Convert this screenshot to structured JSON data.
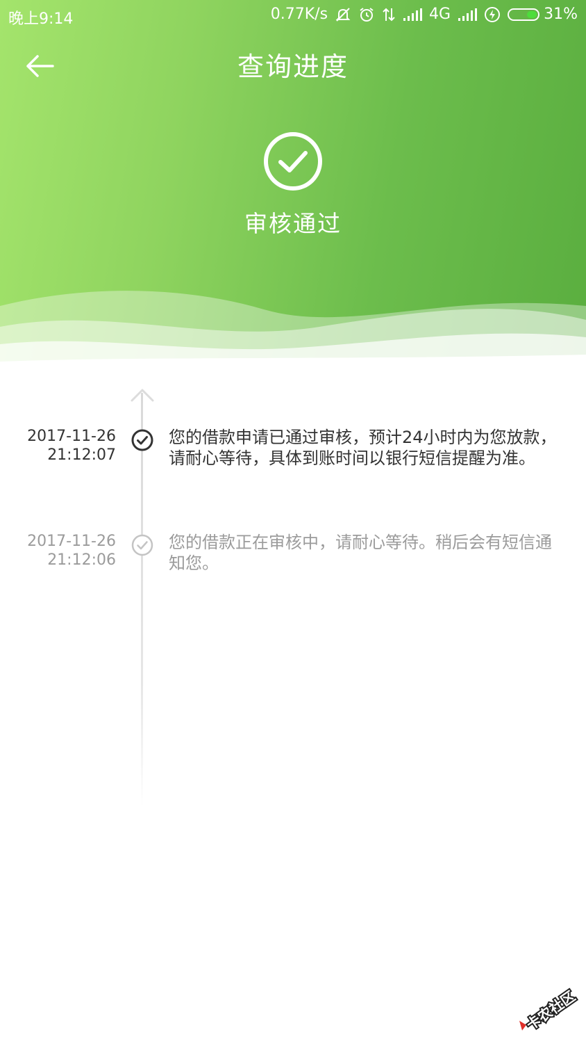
{
  "status_bar": {
    "time": "晚上9:14",
    "net_speed": "0.77K/s",
    "network_type": "4G",
    "battery_percent": "31%",
    "icons": [
      "mute-icon",
      "alarm-icon",
      "data-arrows-icon",
      "signal-icon",
      "signal-icon",
      "charging-icon",
      "battery-icon"
    ]
  },
  "header": {
    "title": "查询进度",
    "back_icon": "back-arrow-icon",
    "status_icon": "check-circle-icon",
    "status_text": "审核通过"
  },
  "timeline": {
    "entries": [
      {
        "date": "2017-11-26",
        "time": "21:12:07",
        "message": "您的借款申请已通过审核，预计24小时内为您放款，请耐心等待，具体到账时间以银行短信提醒为准。",
        "state": "active"
      },
      {
        "date": "2017-11-26",
        "time": "21:12:06",
        "message": "您的借款正在审核中，请耐心等待。稍后会有短信通知您。",
        "state": "inactive"
      }
    ]
  },
  "colors": {
    "header_start": "#a4e46c",
    "header_end": "#5aae3f",
    "text_active": "#333333",
    "text_inactive": "#9b9b9b",
    "battery_fill": "#4ddd3b"
  },
  "watermark": {
    "text": "卡农社区"
  }
}
